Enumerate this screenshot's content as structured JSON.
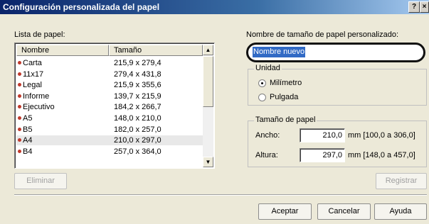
{
  "window": {
    "title": "Configuración personalizada del papel",
    "help_btn": "?",
    "close_btn": "×"
  },
  "list": {
    "label": "Lista de papel:",
    "col_name": "Nombre",
    "col_size": "Tamaño",
    "rows": [
      {
        "name": "Carta",
        "size": "215,9 x 279,4"
      },
      {
        "name": "11x17",
        "size": "279,4 x 431,8"
      },
      {
        "name": "Legal",
        "size": "215,9 x 355,6"
      },
      {
        "name": "Informe",
        "size": "139,7 x 215,9"
      },
      {
        "name": "Ejecutivo",
        "size": "184,2 x 266,7"
      },
      {
        "name": "A5",
        "size": "148,0 x 210,0"
      },
      {
        "name": "B5",
        "size": "182,0 x 257,0"
      },
      {
        "name": "A4",
        "size": "210,0 x 297,0"
      },
      {
        "name": "B4",
        "size": "257,0 x 364,0"
      }
    ],
    "selected_index": 7,
    "scroll_up": "▲",
    "scroll_down": "▼"
  },
  "name_field": {
    "label": "Nombre de tamaño de papel personalizado:",
    "value": "Nombre nuevo"
  },
  "units": {
    "legend": "Unidad",
    "mm": "Milímetro",
    "inch": "Pulgada",
    "selected": "Milímetro"
  },
  "size": {
    "legend": "Tamaño de papel",
    "width_label": "Ancho:",
    "width_value": "210,0",
    "width_range": "mm [100,0 a 306,0]",
    "height_label": "Altura:",
    "height_value": "297,0",
    "height_range": "mm [148,0 a 457,0]"
  },
  "buttons": {
    "delete": "Eliminar",
    "register": "Registrar",
    "ok": "Aceptar",
    "cancel": "Cancelar",
    "help": "Ayuda"
  }
}
